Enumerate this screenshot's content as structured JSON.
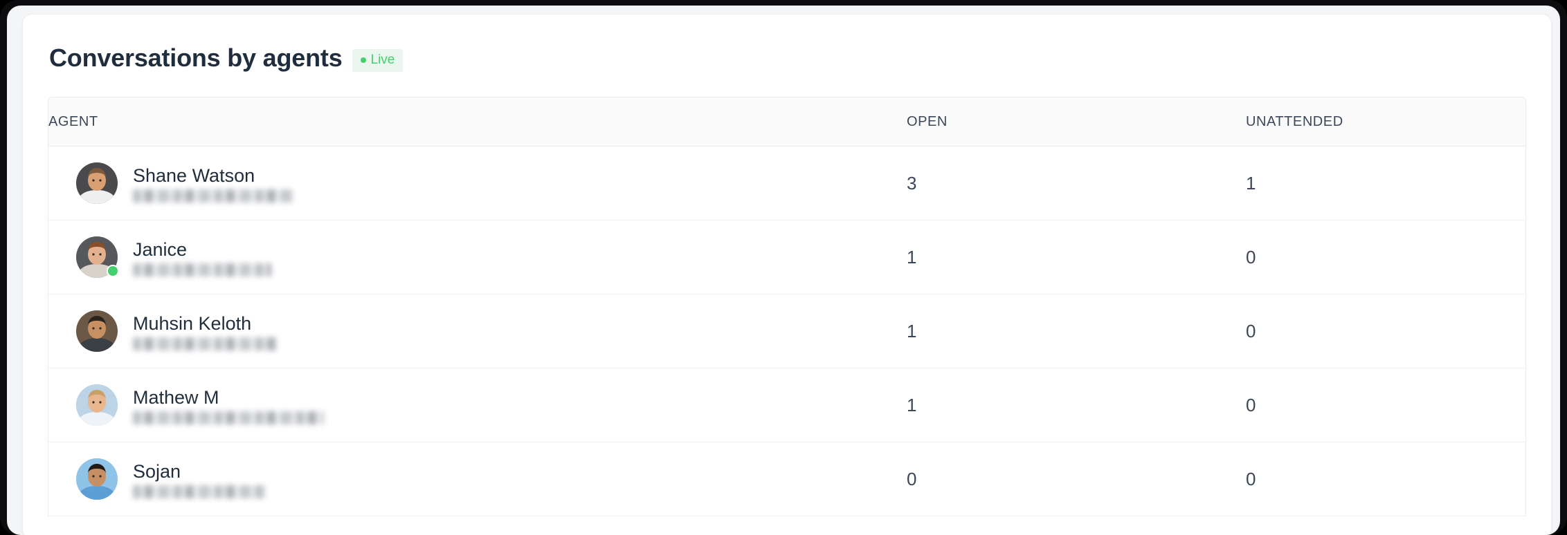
{
  "header": {
    "title": "Conversations by agents",
    "live_badge": {
      "label": "Live",
      "dot_icon": "live-dot-icon",
      "color": "#44ce6f",
      "bg": "#eaf7ee"
    }
  },
  "table": {
    "columns": [
      {
        "key": "agent",
        "label": "AGENT"
      },
      {
        "key": "open",
        "label": "OPEN"
      },
      {
        "key": "unattended",
        "label": "UNATTENDED"
      }
    ],
    "rows": [
      {
        "name": "Shane Watson",
        "email": "[redacted]",
        "open": "3",
        "unattended": "1",
        "online": false,
        "avatar": "photo-man-1"
      },
      {
        "name": "Janice",
        "email": "[redacted]",
        "open": "1",
        "unattended": "0",
        "online": true,
        "avatar": "photo-woman-1"
      },
      {
        "name": "Muhsin Keloth",
        "email": "[redacted]",
        "open": "1",
        "unattended": "0",
        "online": false,
        "avatar": "photo-man-2"
      },
      {
        "name": "Mathew M",
        "email": "[redacted]",
        "open": "1",
        "unattended": "0",
        "online": false,
        "avatar": "photo-man-3"
      },
      {
        "name": "Sojan",
        "email": "[redacted]",
        "open": "0",
        "unattended": "0",
        "online": false,
        "avatar": "photo-man-4"
      }
    ]
  }
}
